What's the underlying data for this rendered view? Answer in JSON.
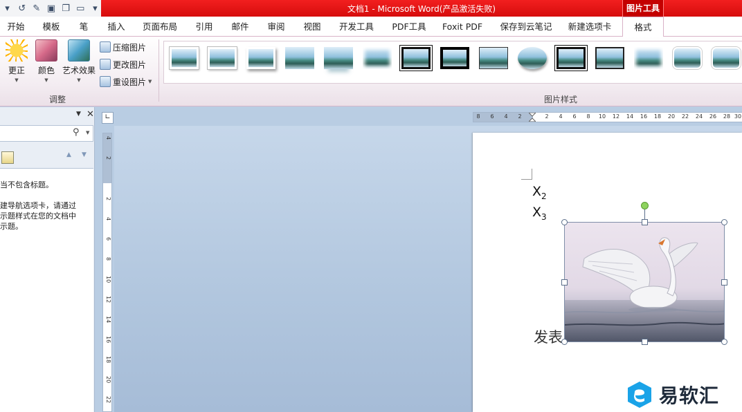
{
  "title_bar": {
    "qat_icons": [
      "dropdown-arrow-icon",
      "redo-icon",
      "edit-icon",
      "print-preview-icon",
      "paste-icon",
      "book-icon",
      "customize-arrow-icon"
    ],
    "title": "文档1 - Microsoft Word(产品激活失败)",
    "context_tab_group": "图片工具",
    "accent": "#e8161a"
  },
  "tabs": [
    {
      "label": "开始"
    },
    {
      "label": "模板"
    },
    {
      "label": "笔"
    },
    {
      "label": "插入"
    },
    {
      "label": "页面布局"
    },
    {
      "label": "引用"
    },
    {
      "label": "邮件"
    },
    {
      "label": "审阅"
    },
    {
      "label": "视图"
    },
    {
      "label": "开发工具"
    },
    {
      "label": "PDF工具"
    },
    {
      "label": "Foxit PDF"
    },
    {
      "label": "保存到云笔记"
    },
    {
      "label": "新建选项卡"
    },
    {
      "label": "格式",
      "active": true
    }
  ],
  "ribbon": {
    "adjust_group": {
      "label": "调整",
      "corrections_label": "更正",
      "color_label": "颜色",
      "artistic_effects_label": "艺术效果",
      "compress_label": "压缩图片",
      "change_label": "更改图片",
      "reset_label": "重设图片"
    },
    "styles_group": {
      "label": "图片样式",
      "style_count": 15
    }
  },
  "nav_pane": {
    "line1": "当不包含标题。",
    "line2": "建导航选项卡，请通过",
    "line3": "示题样式在您的文档中",
    "line4": "示题。"
  },
  "vruler": {
    "labels": [
      "4",
      "2",
      "",
      "2",
      "4",
      "6",
      "8",
      "10",
      "12",
      "14",
      "16",
      "18",
      "20",
      "22"
    ]
  },
  "hruler": {
    "labels": [
      "8",
      "6",
      "4",
      "2",
      "",
      "2",
      "4",
      "6",
      "8",
      "10",
      "12",
      "14",
      "16",
      "18",
      "20",
      "22",
      "24",
      "26",
      "28",
      "30"
    ]
  },
  "document": {
    "x2_base": "X",
    "x2_sub": "2",
    "x3_base": "X",
    "x3_sub": "3",
    "trailing_text": "发表"
  },
  "watermark": {
    "text": "易软汇"
  }
}
